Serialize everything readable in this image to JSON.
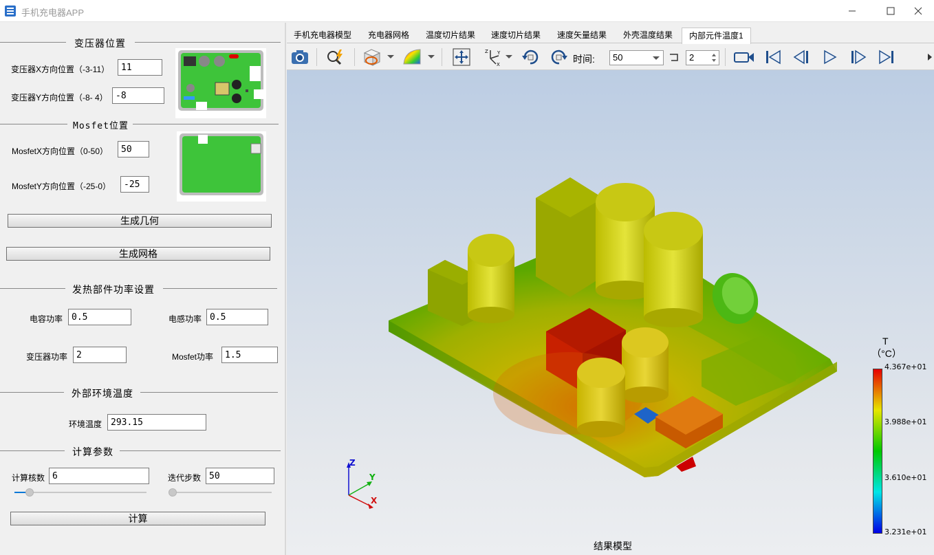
{
  "window": {
    "title": "手机充电器APP"
  },
  "transformer": {
    "title": "变压器位置",
    "x_label": "变压器X方向位置（-3-11）",
    "x_value": "11",
    "y_label": "变压器Y方向位置（-8- 4）",
    "y_value": "-8"
  },
  "mosfet": {
    "title": "Mosfet位置",
    "x_label": "MosfetX方向位置（0-50）",
    "x_value": "50",
    "y_label": "MosfetY方向位置（-25-0）",
    "y_value": "-25"
  },
  "buttons": {
    "gen_geometry": "生成几何",
    "gen_mesh": "生成网格",
    "compute": "计算"
  },
  "power": {
    "title": "发热部件功率设置",
    "cap_label": "电容功率",
    "cap_value": "0.5",
    "ind_label": "电感功率",
    "ind_value": "0.5",
    "trans_label": "变压器功率",
    "trans_value": "2",
    "mos_label": "Mosfet功率",
    "mos_value": "1.5"
  },
  "ambient": {
    "title": "外部环境温度",
    "label": "环境温度",
    "value": "293.15"
  },
  "calc": {
    "title": "计算参数",
    "cores_label": "计算核数",
    "cores_value": "6",
    "steps_label": "迭代步数",
    "steps_value": "50"
  },
  "tabs": [
    "手机充电器模型",
    "充电器网格",
    "温度切片结果",
    "速度切片结果",
    "速度矢量结果",
    "外壳温度结果",
    "内部元件温度1"
  ],
  "toolbar": {
    "time_label": "时间:",
    "time_value": "50",
    "step_value": "2"
  },
  "legend": {
    "title_t": "T",
    "title_unit": "（°C）",
    "labels": [
      "4.367e+01",
      "3.988e+01",
      "3.610e+01",
      "3.231e+01"
    ],
    "colors": [
      "#e60000",
      "#e6e600",
      "#00c800",
      "#00e6e6",
      "#0000e6"
    ]
  },
  "axes": {
    "x": "X",
    "y": "Y",
    "z": "Z"
  },
  "viewport": {
    "caption": "结果模型"
  }
}
